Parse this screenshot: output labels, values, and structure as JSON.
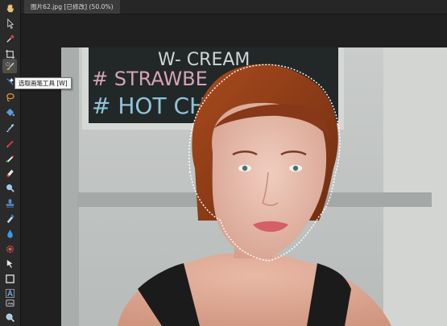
{
  "document": {
    "tab_title": "图片62.jpg [已修改] (50.0%)"
  },
  "tooltip": {
    "text": "选取画笔工具 [W]"
  },
  "photo": {
    "chalkboard_lines": [
      "W- CREAM",
      "# STRAWBE",
      "# HOT CH"
    ]
  },
  "toolbar": {
    "tools": [
      {
        "icon": "hand-icon",
        "active": false
      },
      {
        "icon": "move-pointer-icon",
        "active": false
      },
      {
        "icon": "eyedropper-icon",
        "active": false
      },
      {
        "icon": "crop-icon",
        "active": false
      },
      {
        "icon": "selection-brush-icon",
        "active": true
      },
      {
        "icon": "flood-select-icon",
        "active": false
      },
      {
        "icon": "lasso-icon",
        "active": false
      },
      {
        "icon": "fill-bucket-icon",
        "active": false
      },
      {
        "icon": "paint-brush-icon",
        "active": false
      },
      {
        "icon": "pencil-icon",
        "active": false
      },
      {
        "icon": "color-brush-icon",
        "active": false
      },
      {
        "icon": "erase-brush-icon",
        "active": false
      },
      {
        "icon": "dodge-icon",
        "active": false
      },
      {
        "icon": "clone-stamp-icon",
        "active": false
      },
      {
        "icon": "healing-brush-icon",
        "active": false
      },
      {
        "icon": "blur-drop-icon",
        "active": false
      },
      {
        "icon": "red-eye-icon",
        "active": false
      },
      {
        "icon": "pen-node-icon",
        "active": false
      },
      {
        "icon": "rectangle-shape-icon",
        "active": false
      },
      {
        "icon": "text-tool-icon",
        "active": false
      },
      {
        "icon": "view-icon",
        "active": false
      },
      {
        "icon": "zoom-icon",
        "active": false
      }
    ]
  },
  "colors": {
    "accent_red": "#d9383a",
    "accent_blue": "#3a7bd5",
    "hair": "#8b3d17"
  }
}
